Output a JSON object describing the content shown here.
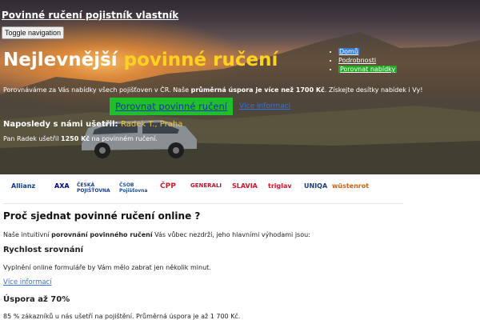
{
  "navbar": {
    "brand": "Povinné ručení pojistník vlastník",
    "toggle_label": "Toggle navigation",
    "items": [
      {
        "label": "Domů"
      },
      {
        "label": "Podrobnosti"
      },
      {
        "label": "Porovnat nabídky"
      }
    ]
  },
  "hero": {
    "title_part1": "Nejlevnější ",
    "title_part2": "povinné ručení",
    "desc_part1": "Porovnáváme za Vás nabídky všech pojišťoven v ČR. Naše ",
    "desc_bold": "průměrná úspora je více než 1700 Kč",
    "desc_part2": ". Získejte desítky nabídek i Vy!",
    "cta_label": "Porovnat povinné ručení",
    "more_label": "Více informací",
    "saved_label": "Naposledy s námi ušetřil: ",
    "saved_name": "Radek T., Praha",
    "saved_detail_part1": "Pan Radek ušetřil ",
    "saved_detail_amount": "1250 Kč",
    "saved_detail_part2": " na povinném ručení."
  },
  "insurers": [
    {
      "name": "Allianz",
      "color": "#0a3d91"
    },
    {
      "name": "AXA",
      "color": "#00008f"
    },
    {
      "name": "ČESKÁ POJIŠŤOVNA",
      "color": "#1a3d8f"
    },
    {
      "name": "ČSOB Pojišťovna",
      "color": "#1a4f9a"
    },
    {
      "name": "ČPP",
      "color": "#cc1f2b"
    },
    {
      "name": "GENERALI",
      "color": "#c8102e"
    },
    {
      "name": "SLAVIA",
      "color": "#d4142c"
    },
    {
      "name": "triglav",
      "color": "#d4142c"
    },
    {
      "name": "UNIQA",
      "color": "#1a3d7a"
    },
    {
      "name": "wüstenrot",
      "color": "#d06010"
    }
  ],
  "content": {
    "title": "Proč sjednat povinné ručení online ?",
    "intro_part1": "Naše intuitivní ",
    "intro_bold": "porovnání povinného ručení",
    "intro_part2": " Vás vůbec nezdrží, jeho hlavními výhodami jsou:",
    "feature1_title": "Rychlost srovnání",
    "feature1_text": "Vyplnění online formuláře by Vám mělo zabrat jen několik minut.",
    "feature1_link": "Více informací",
    "feature2_title": "Úspora až 70%",
    "feature2_text": "85 % zákazníků u nás ušetří na pojištění. Průměrná úspora je až 1 700 Kč."
  }
}
